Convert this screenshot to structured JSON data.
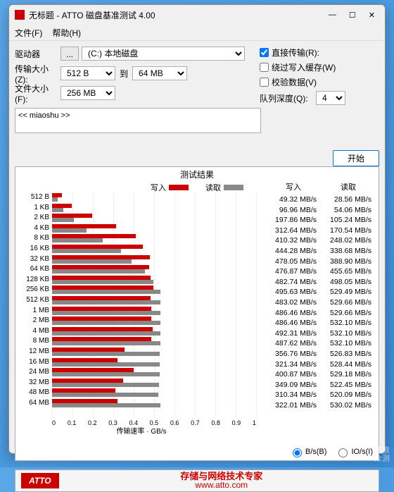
{
  "title": "无标题 - ATTO 磁盘基准测试 4.00",
  "menu": {
    "file": "文件(F)",
    "help": "帮助(H)"
  },
  "labels": {
    "drive": "驱动器",
    "transfer": "传输大小(Z):",
    "to": "到",
    "file": "文件大小(F):",
    "direct": "直接传输(R):",
    "bypass": "绕过写入缓存(W)",
    "verify": "校验数据(V)",
    "queue": "队列深度(Q):",
    "start": "开始",
    "desc": "<< miaoshu >>",
    "results": "测试结果",
    "write": "写入",
    "read": "读取",
    "rate": "传输速率 · GB/s",
    "bs": "B/s(B)",
    "ios": "IO/s(I)"
  },
  "sel": {
    "drive": "(C:) 本地磁盘",
    "tmin": "512 B",
    "tmax": "64 MB",
    "fsize": "256 MB",
    "queue": "4"
  },
  "chk": {
    "direct": true,
    "bypass": false,
    "verify": false
  },
  "footer": {
    "brand": "ATTO",
    "slogan": "存储与网络技术专家",
    "url": "www.atto.com"
  },
  "watermark": {
    "l1": "新浪",
    "l2": "众测"
  },
  "chart_data": {
    "type": "bar",
    "xlabel": "传输速率 · GB/s",
    "xticks": [
      "0",
      "0.1",
      "0.2",
      "0.3",
      "0.4",
      "0.5",
      "0.6",
      "0.7",
      "0.8",
      "0.9",
      "1"
    ],
    "xlim": [
      0,
      1
    ],
    "categories": [
      "512 B",
      "1 KB",
      "2 KB",
      "4 KB",
      "8 KB",
      "16 KB",
      "32 KB",
      "64 KB",
      "128 KB",
      "256 KB",
      "512 KB",
      "1 MB",
      "2 MB",
      "4 MB",
      "8 MB",
      "12 MB",
      "16 MB",
      "24 MB",
      "32 MB",
      "48 MB",
      "64 MB"
    ],
    "series": [
      {
        "name": "写入",
        "unit": "MB/s",
        "values": [
          49.32,
          96.96,
          197.86,
          312.64,
          410.32,
          444.28,
          478.05,
          476.87,
          482.74,
          495.63,
          483.02,
          486.46,
          486.46,
          492.31,
          487.62,
          356.76,
          321.34,
          400.87,
          349.09,
          310.34,
          322.01
        ]
      },
      {
        "name": "读取",
        "unit": "MB/s",
        "values": [
          28.56,
          54.06,
          105.24,
          170.54,
          248.02,
          338.68,
          388.9,
          455.65,
          498.05,
          529.49,
          529.66,
          529.66,
          532.1,
          532.1,
          532.1,
          526.83,
          528.44,
          529.18,
          522.45,
          520.09,
          530.02
        ]
      }
    ]
  }
}
